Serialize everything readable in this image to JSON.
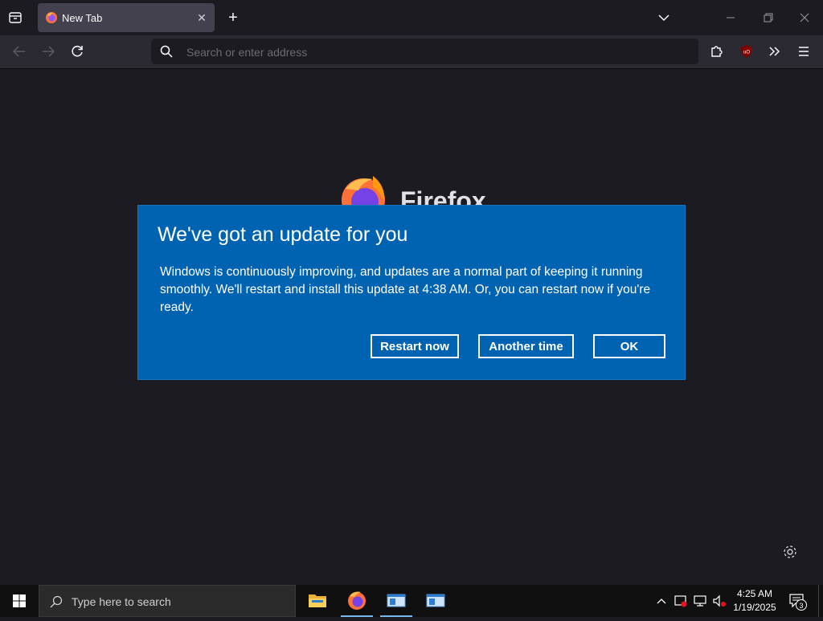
{
  "browser": {
    "tab": {
      "title": "New Tab"
    },
    "urlbar": {
      "placeholder": "Search or enter address"
    },
    "newtab": {
      "wordmark": "Firefox"
    }
  },
  "dialog": {
    "title": "We've got an update for you",
    "body": "Windows is continuously improving, and updates are a normal part of keeping it running smoothly. We'll restart and install this update at 4:38 AM. Or, you can restart now if you're ready.",
    "buttons": {
      "restart": "Restart now",
      "another": "Another time",
      "ok": "OK"
    },
    "background": "#0063b1"
  },
  "taskbar": {
    "search_placeholder": "Type here to search",
    "apps": [
      {
        "name": "File Explorer",
        "icon": "folder-icon"
      },
      {
        "name": "Firefox",
        "icon": "firefox-icon"
      },
      {
        "name": "Window 1",
        "icon": "window-icon"
      },
      {
        "name": "Window 2",
        "icon": "window-icon"
      }
    ],
    "clock": {
      "time": "4:25 AM",
      "date": "1/19/2025"
    },
    "notification_count": "3"
  }
}
